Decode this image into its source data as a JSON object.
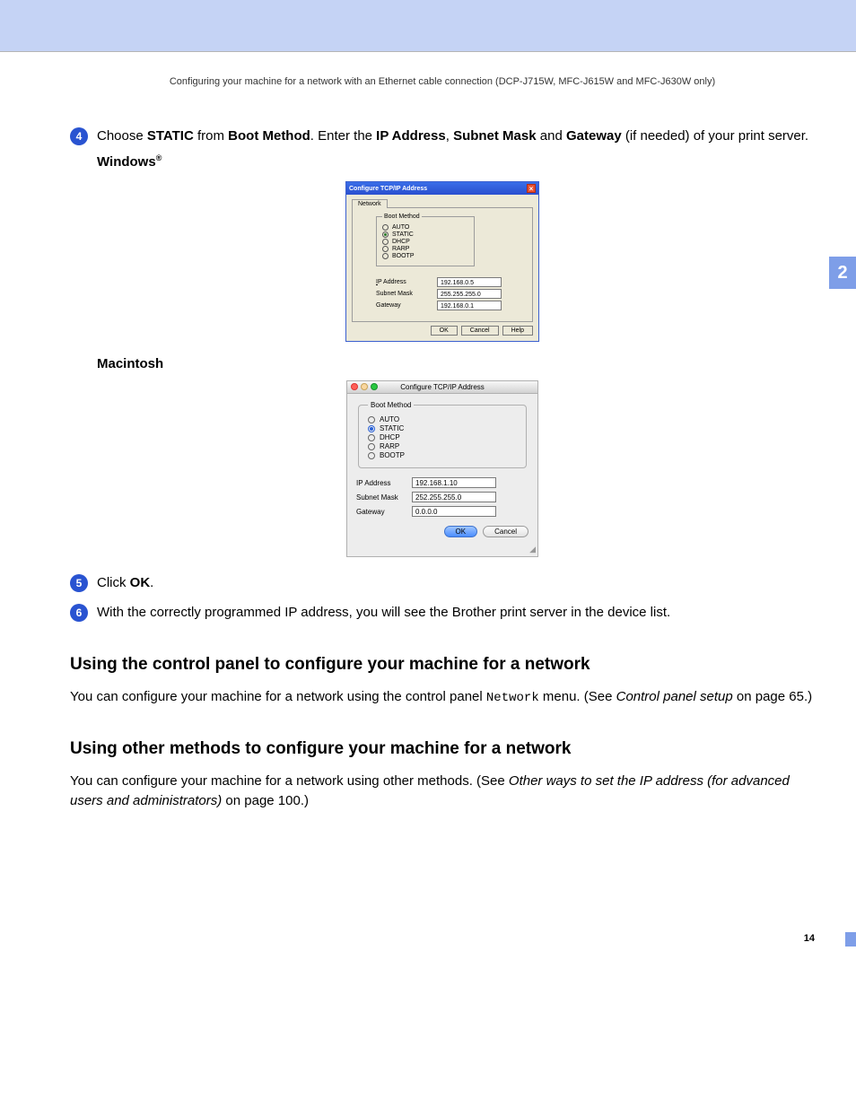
{
  "chapter_tab": "2",
  "header_line": "Configuring your machine for a network with an Ethernet cable connection (DCP-J715W, MFC-J615W and MFC-J630W only)",
  "step4": {
    "badge": "4",
    "text_pre": "Choose ",
    "bold1": "STATIC",
    "text_mid1": " from ",
    "bold2": "Boot Method",
    "text_mid2": ". Enter the ",
    "bold3": "IP Address",
    "text_mid3": ", ",
    "bold4": "Subnet Mask",
    "text_mid4": " and ",
    "bold5": "Gateway",
    "text_end": " (if needed) of your print server.",
    "os_win": "Windows",
    "os_mac": "Macintosh"
  },
  "win_dialog": {
    "title": "Configure TCP/IP Address",
    "tab": "Network",
    "fieldset": "Boot Method",
    "radios": [
      "AUTO",
      "STATIC",
      "DHCP",
      "RARP",
      "BOOTP"
    ],
    "selected": "STATIC",
    "labels": {
      "ip": "IP Address",
      "mask": "Subnet Mask",
      "gw": "Gateway"
    },
    "values": {
      "ip": "192.168.0.5",
      "mask": "255.255.255.0",
      "gw": "192.168.0.1"
    },
    "buttons": {
      "ok": "OK",
      "cancel": "Cancel",
      "help": "Help"
    }
  },
  "mac_dialog": {
    "title": "Configure TCP/IP Address",
    "fieldset": "Boot Method",
    "radios": [
      "AUTO",
      "STATIC",
      "DHCP",
      "RARP",
      "BOOTP"
    ],
    "selected": "STATIC",
    "labels": {
      "ip": "IP Address",
      "mask": "Subnet Mask",
      "gw": "Gateway"
    },
    "values": {
      "ip": "192.168.1.10",
      "mask": "252.255.255.0",
      "gw": "0.0.0.0"
    },
    "buttons": {
      "ok": "OK",
      "cancel": "Cancel"
    }
  },
  "step5": {
    "badge": "5",
    "pre": "Click ",
    "bold": "OK",
    "post": "."
  },
  "step6": {
    "badge": "6",
    "text": "With the correctly programmed IP address, you will see the Brother print server in the device list."
  },
  "section1": {
    "heading": "Using the control panel to configure your machine for a network",
    "p_pre": "You can configure your machine for a network using the control panel ",
    "p_mono": "Network",
    "p_mid": " menu. (See ",
    "p_italic": "Control panel setup",
    "p_post": " on page 65.)"
  },
  "section2": {
    "heading": "Using other methods to configure your machine for a network",
    "p_pre": "You can configure your machine for a network using other methods. (See ",
    "p_italic": "Other ways to set the IP address (for advanced users and administrators)",
    "p_post": " on page 100.)"
  },
  "page_number": "14"
}
